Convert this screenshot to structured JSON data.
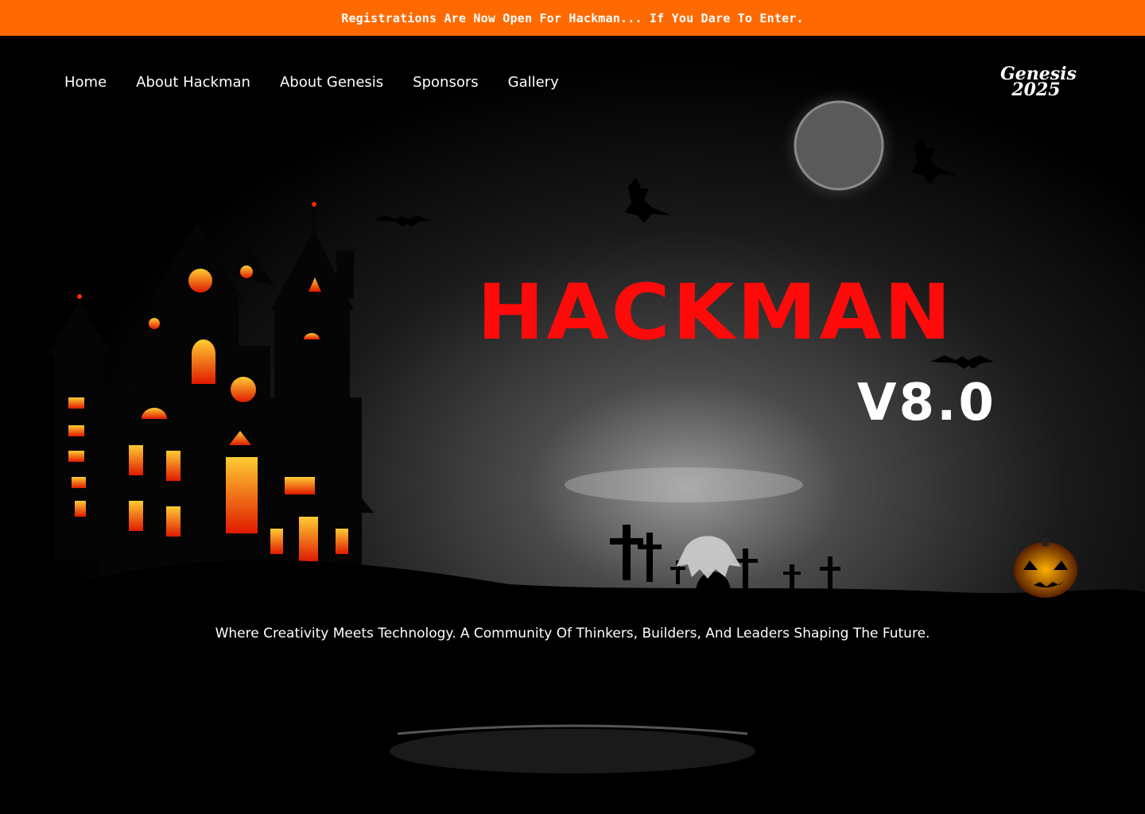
{
  "banner": {
    "text": "Registrations Are Now Open For Hackman... If You Dare To Enter."
  },
  "nav": {
    "items": [
      {
        "label": "Home"
      },
      {
        "label": "About Hackman"
      },
      {
        "label": "About Genesis"
      },
      {
        "label": "Sponsors"
      },
      {
        "label": "Gallery"
      }
    ]
  },
  "logo": {
    "line1": "Genesis",
    "line2": "2025"
  },
  "hero": {
    "title": "HACKMAN",
    "version": "V8.0",
    "tagline": "Where Creativity Meets Technology. A Community Of Thinkers, Builders, And Leaders Shaping The Future."
  },
  "colors": {
    "banner": "#ff6a00",
    "title": "#ff0a0a",
    "background": "#000000",
    "window_glow": "#ff8a00"
  }
}
